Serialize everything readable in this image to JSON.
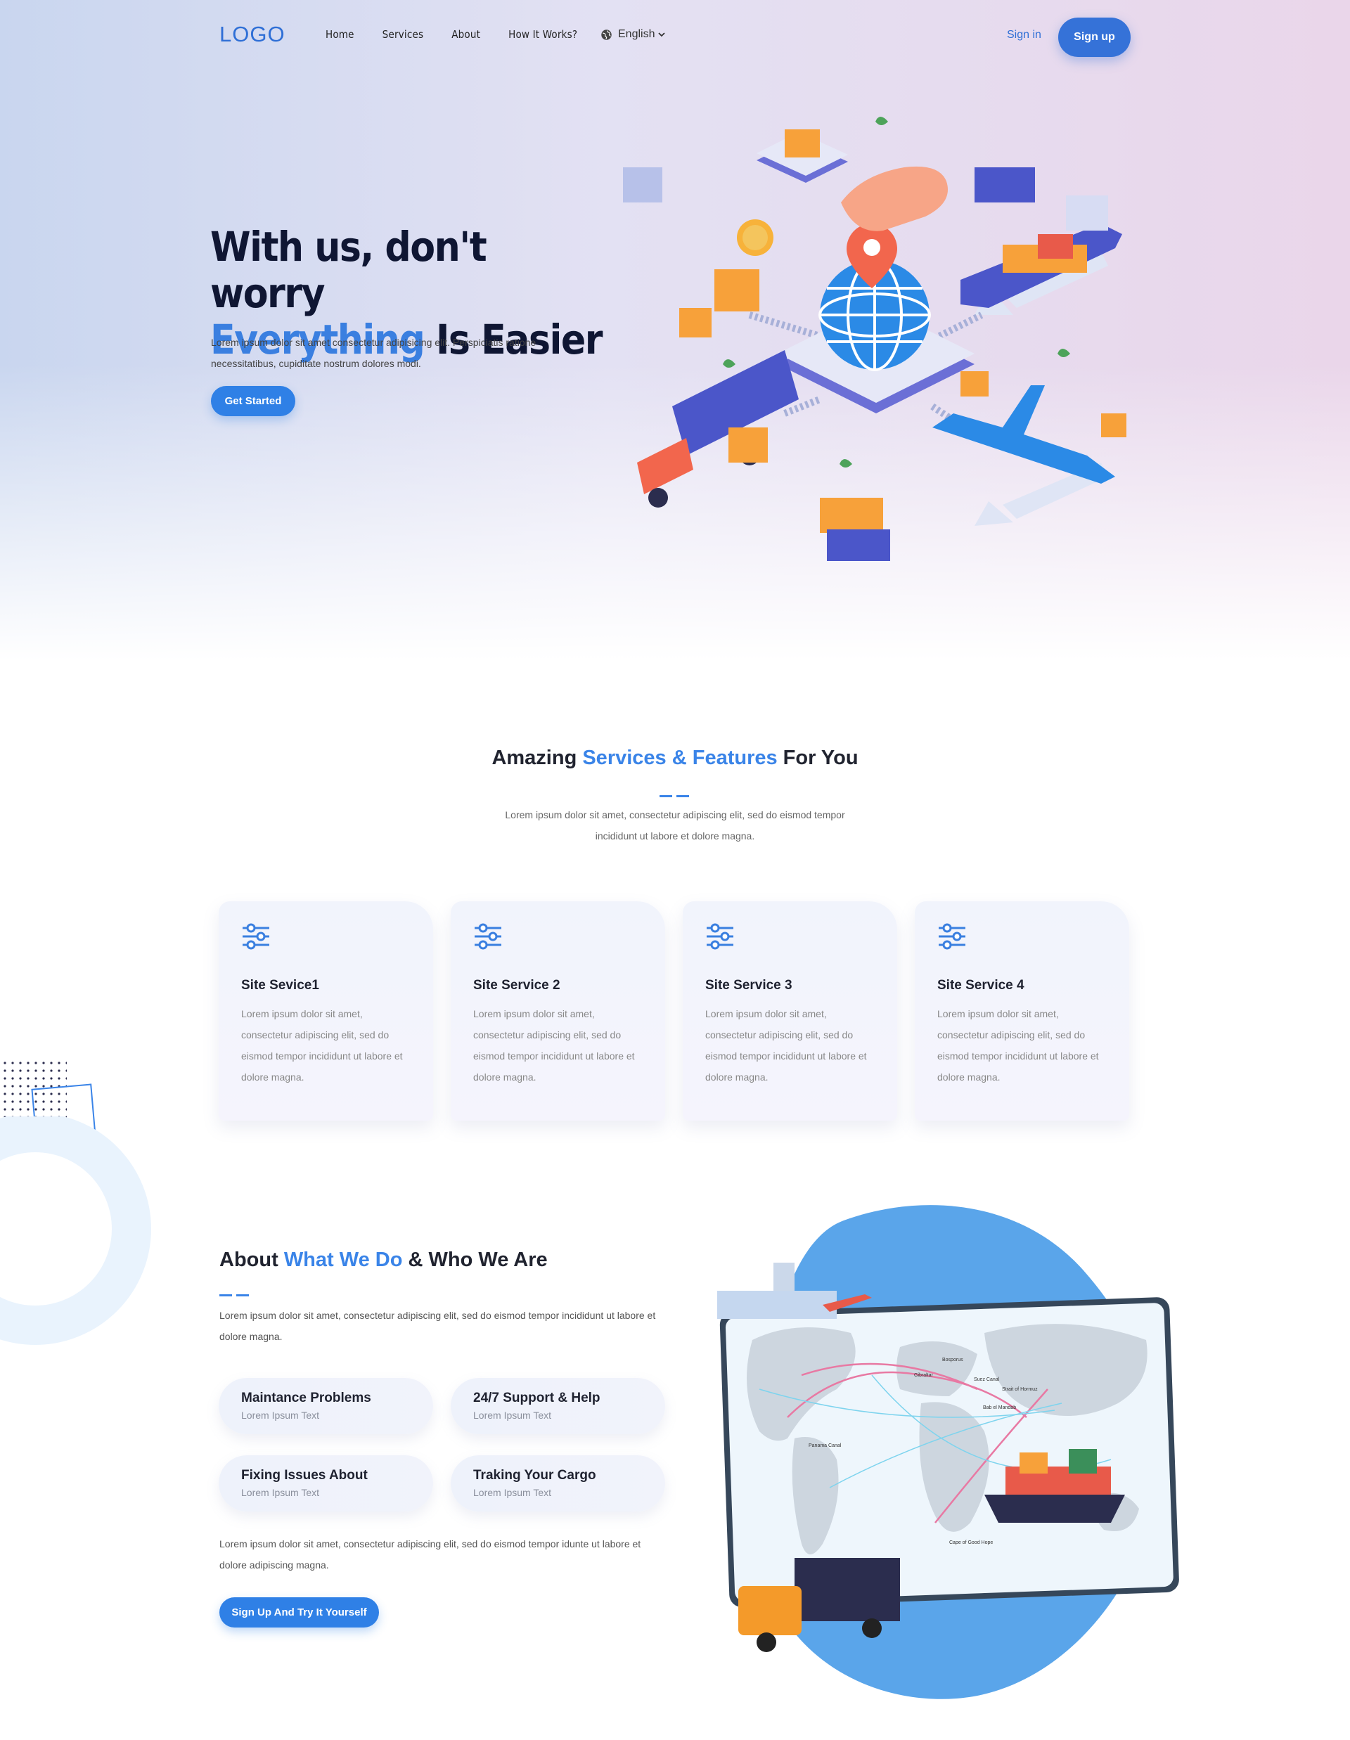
{
  "nav": {
    "logo": "LOGO",
    "items": [
      "Home",
      "Services",
      "About",
      "How It Works?"
    ],
    "language": "English",
    "sign_in": "Sign in",
    "sign_up": "Sign up"
  },
  "hero": {
    "title_line1": "With us, don't worry",
    "title_accent": "Everything",
    "title_rest": " Is Easier",
    "description": "Lorem ipsum dolor sit amet consectetur adipisicing elit. Perspiciatis ratione necessitatibus, cupiditate nostrum dolores modi.",
    "cta": "Get Started"
  },
  "services": {
    "title_pre": "Amazing ",
    "title_accent": "Services & Features",
    "title_post": " For You",
    "description": "Lorem ipsum dolor sit amet, consectetur adipiscing elit, sed do eismod tempor incididunt ut labore et dolore magna.",
    "cards": [
      {
        "title": "Site Sevice1",
        "text": "Lorem ipsum dolor sit amet, consectetur adipiscing elit, sed do eismod tempor incididunt ut labore et dolore magna."
      },
      {
        "title": "Site Service 2",
        "text": "Lorem ipsum dolor sit amet, consectetur adipiscing elit, sed do eismod tempor incididunt ut labore et dolore magna."
      },
      {
        "title": "Site Service 3",
        "text": "Lorem ipsum dolor sit amet, consectetur adipiscing elit, sed do eismod tempor incididunt ut labore et dolore magna."
      },
      {
        "title": "Site Service 4",
        "text": "Lorem ipsum dolor sit amet, consectetur adipiscing elit, sed do eismod tempor incididunt ut labore et dolore magna."
      }
    ]
  },
  "about": {
    "title_pre": "About ",
    "title_accent": "What We Do",
    "title_post": " & Who We Are",
    "description": "Lorem ipsum dolor sit amet, consectetur adipiscing elit, sed do eismod tempor incididunt ut labore et dolore magna.",
    "features": [
      {
        "title": "Maintance Problems",
        "sub": "Lorem Ipsum Text"
      },
      {
        "title": "24/7 Support & Help",
        "sub": "Lorem Ipsum Text"
      },
      {
        "title": "Fixing Issues About",
        "sub": "Lorem Ipsum Text"
      },
      {
        "title": "Traking Your Cargo",
        "sub": "Lorem Ipsum Text"
      }
    ],
    "description2": "Lorem ipsum dolor sit amet, consectetur adipiscing elit, sed do eismod tempor idunte ut labore et dolore adipiscing magna.",
    "cta": "Sign Up And Try It Yourself",
    "map_labels": [
      "Bosporus",
      "Gibraltar",
      "Suez Canal",
      "Strait of Hormuz",
      "Bab el Mandab",
      "Panama Canal",
      "Cape of Good Hope"
    ]
  },
  "colors": {
    "accent": "#3a84e8",
    "button": "#2f80e6",
    "heading": "#0f1633"
  }
}
